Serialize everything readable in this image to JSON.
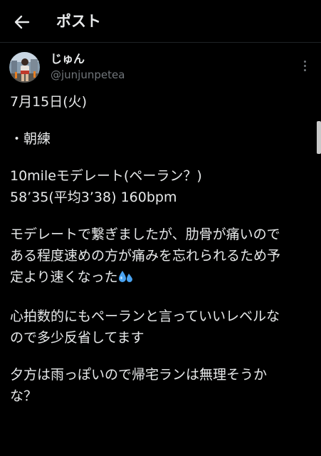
{
  "header": {
    "title": "ポスト",
    "back_icon": "arrow-left-icon"
  },
  "author": {
    "display_name": "じゅん",
    "handle": "@junjunpetea",
    "avatar_icon": "runner-photo-avatar"
  },
  "post": {
    "date_line": "7月15日(火)",
    "bullet_line": "・朝練",
    "workout_line1": "10mileモデレート(ペーラン？)",
    "workout_line2": "58’35(平均3’38) 160bpm",
    "para1_line1": "モデレートで繋ぎましたが、肋骨が痛いので",
    "para1_line2": "ある程度速めの方が痛みを忘れられるため予",
    "para1_line3": "定より速くなった",
    "para1_emoji": "sweat-droplets-icon",
    "para2_line1": "心拍数的にもペーランと言っていいレベルな",
    "para2_line2": "ので多少反省してます",
    "para3_line1": "夕方は雨っぽいので帰宅ランは無理そうか",
    "para3_line2": "な？"
  },
  "colors": {
    "background": "#000000",
    "text": "#e7e9ea",
    "secondary_text": "#71767b",
    "emoji_blue": "#4aa3f0"
  }
}
